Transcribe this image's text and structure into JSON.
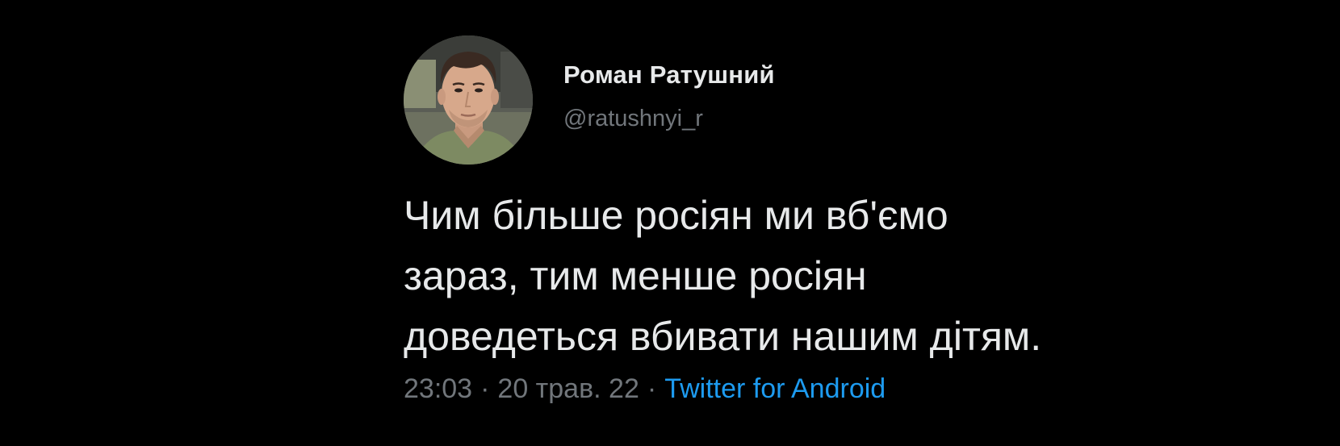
{
  "tweet": {
    "author": {
      "display_name": "Роман Ратушний",
      "handle": "@ratushnyi_r"
    },
    "text_lines": [
      "Чим більше росіян ми вб'ємо",
      "зараз, тим менше росіян",
      "доведеться вбивати нашим дітям."
    ],
    "meta": {
      "time": "23:03",
      "separator": "·",
      "date": "20 трав. 22",
      "source": "Twitter for Android"
    }
  },
  "colors": {
    "background": "#000000",
    "text_primary": "#e7e9ea",
    "text_secondary": "#71767b",
    "link": "#1d9bf0"
  }
}
